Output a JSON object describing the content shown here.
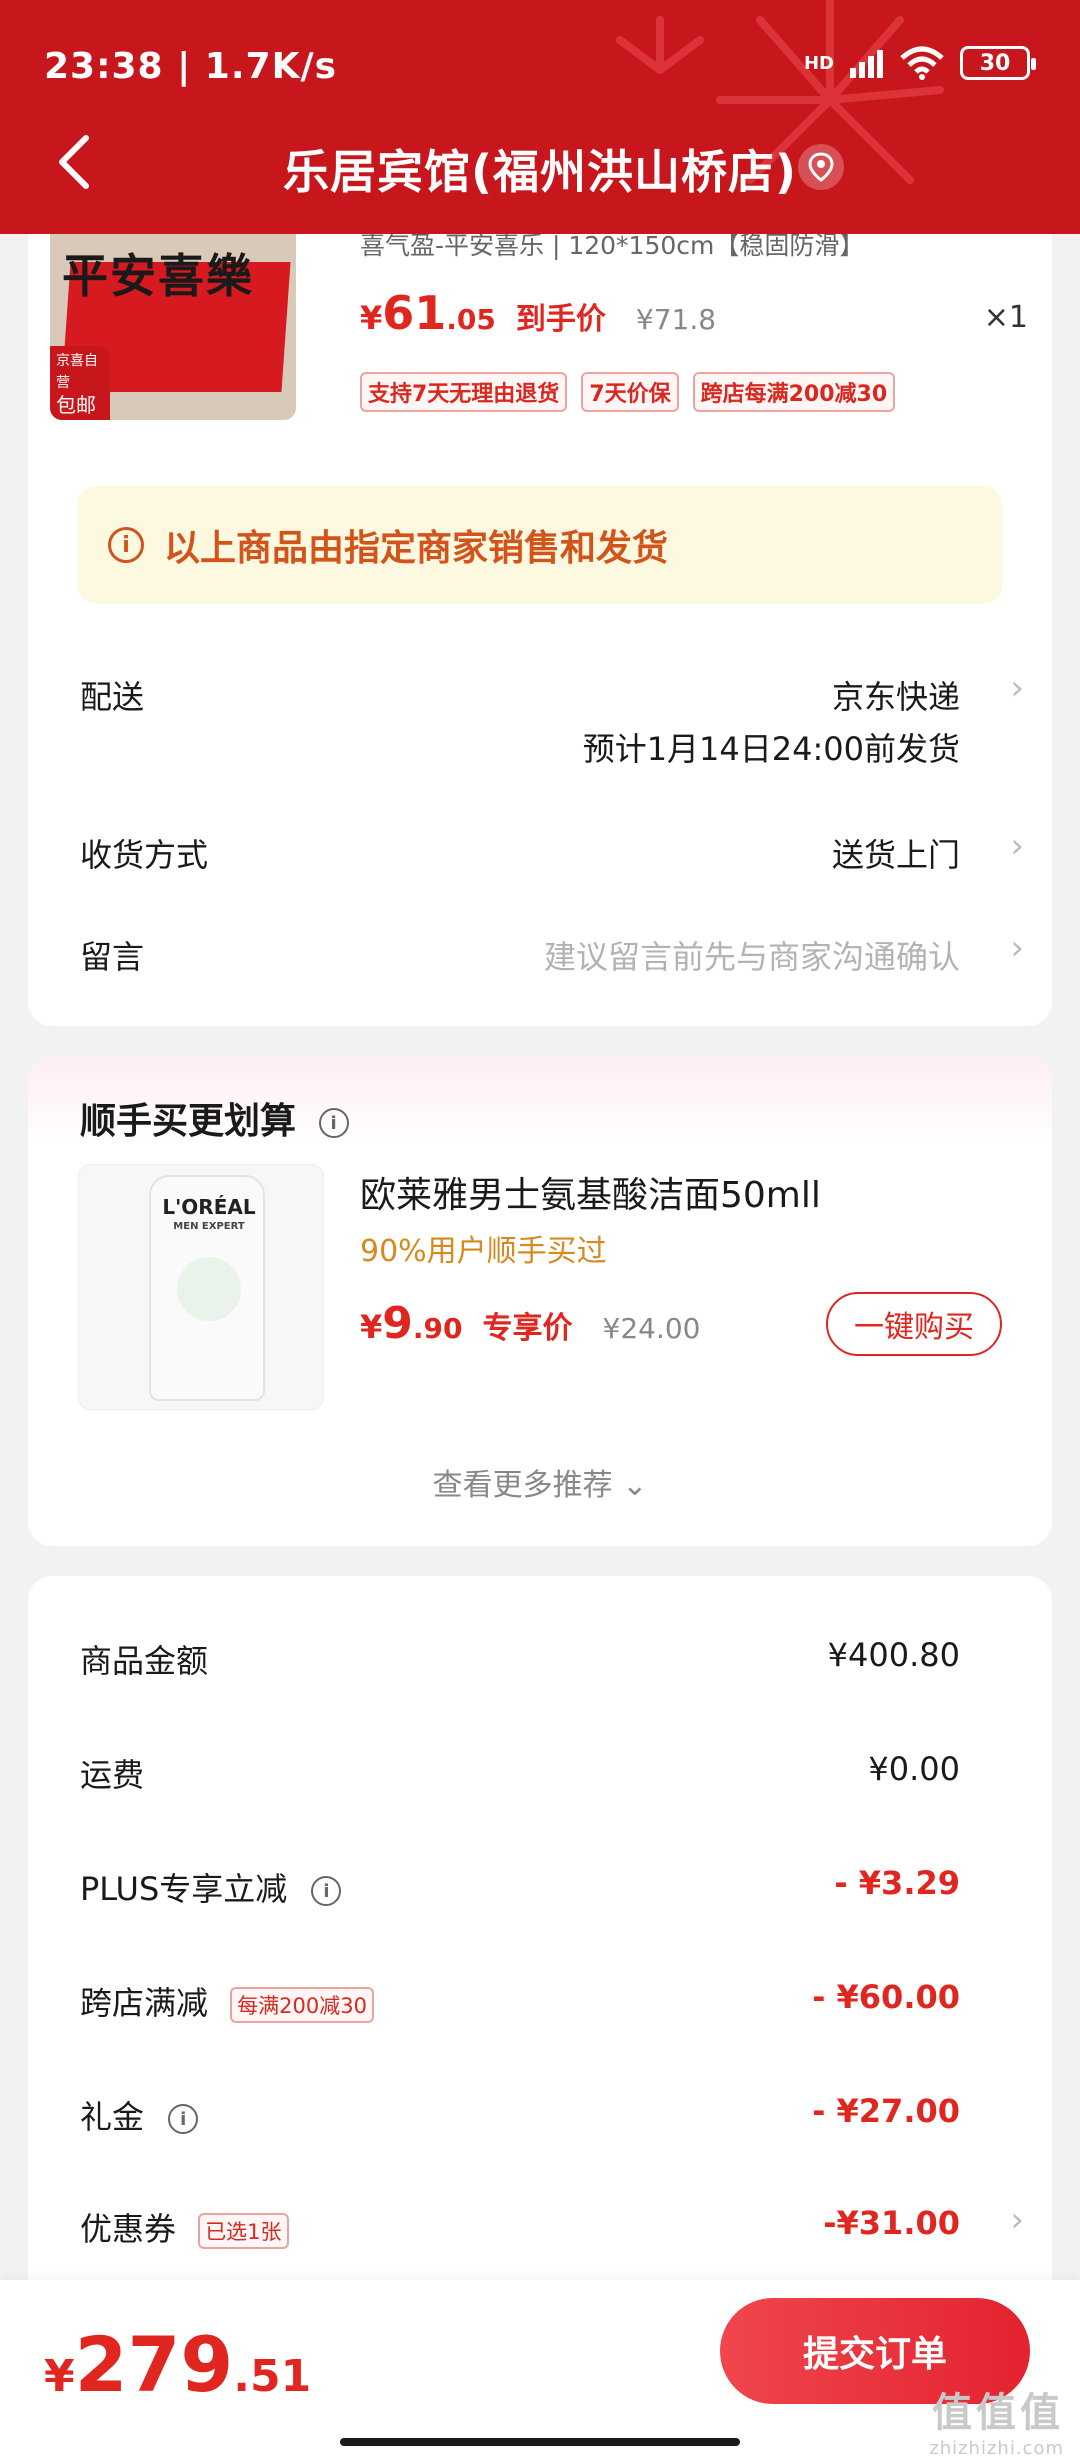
{
  "status_bar": {
    "time_speed": "23:38 | 1.7K/s",
    "network": "HD",
    "battery": "30"
  },
  "header": {
    "title": "乐居宾馆(福州洪山桥店)"
  },
  "product": {
    "title": "喜气盈-平安喜乐 | 120*150cm【稳固防滑】",
    "image_text": "平安喜樂",
    "image_badge_top": "京喜自营",
    "image_badge_bottom": "包邮",
    "price_symbol": "¥",
    "price_int": "61",
    "price_dec": ".05",
    "price_tag": "到手价",
    "original_price": "¥71.8",
    "quantity": "×1",
    "tags": [
      "支持7天无理由退货",
      "7天价保",
      "跨店每满200减30"
    ]
  },
  "notice": {
    "icon": "i",
    "text": "以上商品由指定商家销售和发货"
  },
  "delivery": {
    "label": "配送",
    "value": "京东快递",
    "estimate": "预计1月14日24:00前发货"
  },
  "receive": {
    "label": "收货方式",
    "value": "送货上门"
  },
  "message": {
    "label": "留言",
    "placeholder": "建议留言前先与商家沟通确认"
  },
  "recommend": {
    "section_title": "顺手买更划算",
    "info_icon": "i",
    "image_brand": "L'ORÉAL",
    "image_sub": "MEN EXPERT",
    "title": "欧莱雅男士氨基酸洁面50mll",
    "subtitle": "90%用户顺手买过",
    "price_symbol": "¥",
    "price_int": "9",
    "price_dec": ".90",
    "price_tag": "专享价",
    "original_price": "¥24.00",
    "buy_label": "一键购买",
    "more_label": "查看更多推荐"
  },
  "summary": {
    "goods_amount": {
      "label": "商品金额",
      "value": "¥400.80"
    },
    "shipping": {
      "label": "运费",
      "value": "¥0.00"
    },
    "plus": {
      "label": "PLUS专享立减",
      "info_icon": "i",
      "value": "- ¥3.29"
    },
    "cross_store": {
      "label": "跨店满减",
      "tag": "每满200减30",
      "value": "- ¥60.00"
    },
    "gift": {
      "label": "礼金",
      "info_icon": "i",
      "value": "- ¥27.00"
    },
    "coupon": {
      "label": "优惠券",
      "tag": "已选1张",
      "value": "-¥31.00"
    }
  },
  "bottom": {
    "total_symbol": "¥",
    "total_int": "279",
    "total_dec": ".51",
    "submit_label": "提交订单"
  },
  "watermark": {
    "top": "值值值",
    "bottom": "zhizhizhi.com"
  },
  "colors": {
    "header": "#c8161d",
    "accent_red": "#e0261f",
    "notice_bg": "#fdf8e0",
    "notice_text": "#d2541b",
    "subtitle_orange": "#d68a1e"
  }
}
